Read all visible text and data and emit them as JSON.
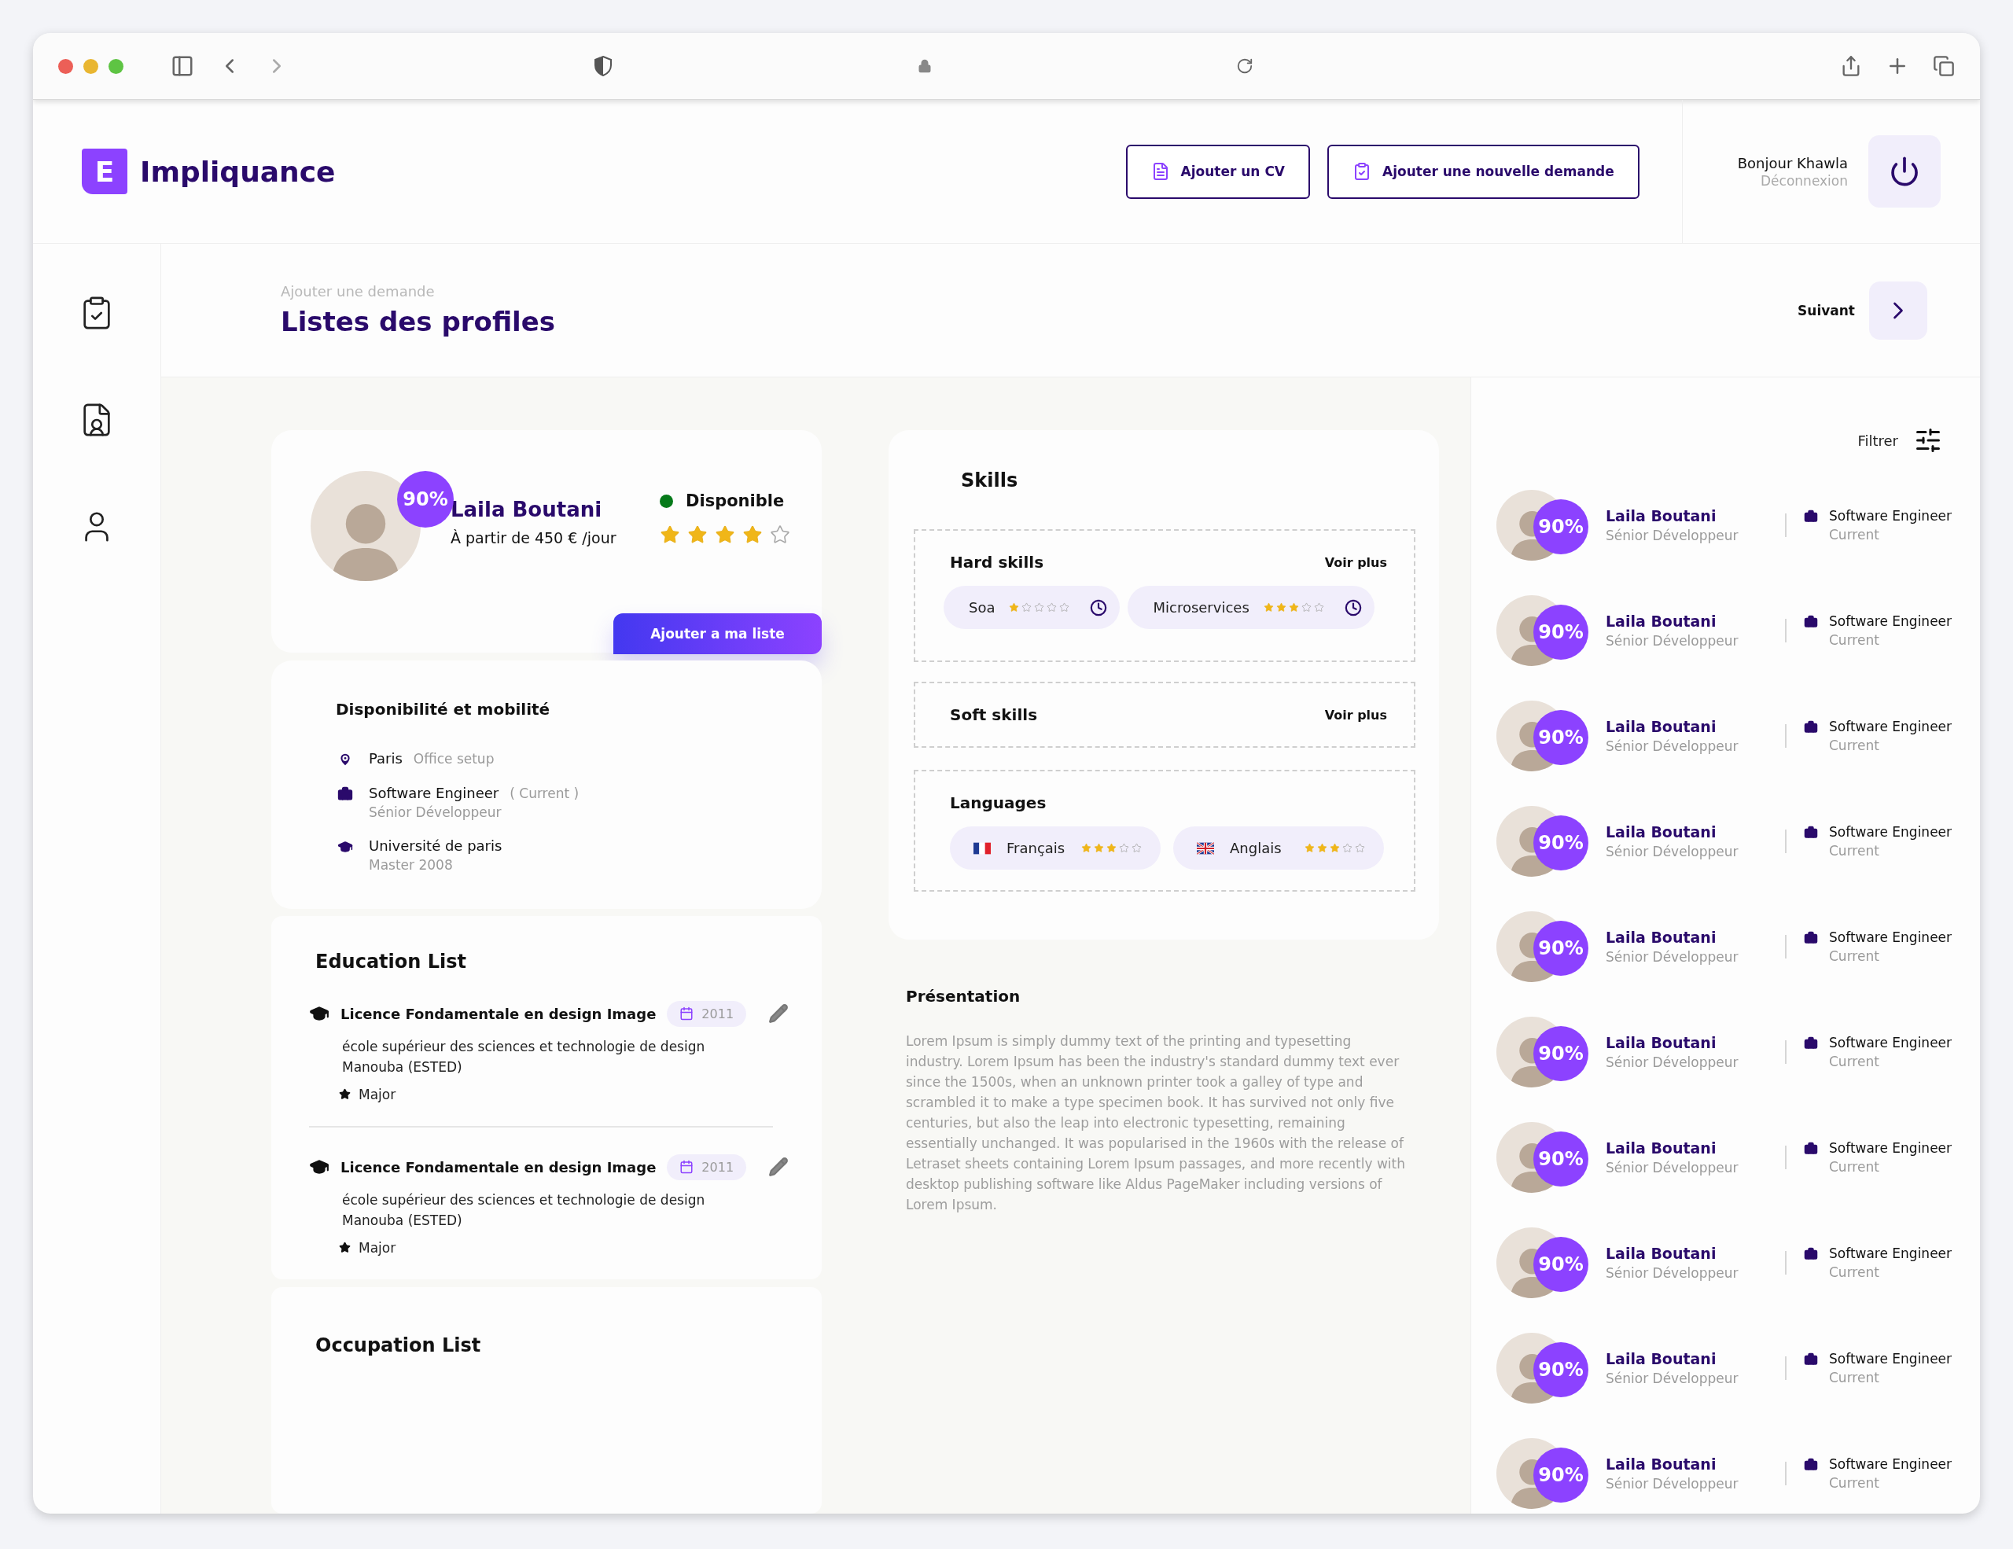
{
  "header": {
    "logo": {
      "mark": "E",
      "name": "Impliquance"
    },
    "buttons": [
      {
        "kind": "cv",
        "label": "Ajouter un CV"
      },
      {
        "kind": "request",
        "label": "Ajouter une nouvelle demande"
      }
    ],
    "user": {
      "greeting": "Bonjour Khawla",
      "logout": "Déconnexion"
    }
  },
  "page": {
    "breadcrumb": "Ajouter une demande",
    "title": "Listes des profiles",
    "next": "Suivant"
  },
  "profile": {
    "score": "90%",
    "name": "Laila Boutani",
    "rate": "À partir de 450 € /jour",
    "status": {
      "label": "Disponible",
      "available": true
    },
    "stars": 4,
    "add_button": "Ajouter a ma liste"
  },
  "mobility": {
    "title": "Disponibilité et mobilité",
    "items": [
      {
        "kind": "location",
        "label": "Paris",
        "note": "Office setup"
      },
      {
        "kind": "job",
        "label": "Software Engineer",
        "note": "( Current )",
        "sub": "Sénior Développeur"
      },
      {
        "kind": "school",
        "label": "Université de paris",
        "sub": "Master 2008"
      }
    ]
  },
  "skills": {
    "title": "Skills",
    "hard_skills": {
      "title": "Hard skills",
      "more": "Voir plus",
      "items": [
        {
          "name": "Soa",
          "stars": 1
        },
        {
          "name": "Microservices",
          "stars": 3
        }
      ]
    },
    "soft_skills": {
      "title": "Soft skills",
      "more": "Voir plus"
    },
    "languages": {
      "title": "Languages",
      "items": [
        {
          "name": "Français",
          "kind": "fr",
          "stars": 3
        },
        {
          "name": "Anglais",
          "kind": "gb",
          "stars": 3
        }
      ]
    }
  },
  "presentation": {
    "title": "Présentation",
    "text": "Lorem Ipsum is simply dummy text of the printing and typesetting industry. Lorem Ipsum has been the industry's standard dummy text ever since the 1500s, when an unknown printer took a galley of type and scrambled it to make a type specimen book. It has survived not only five centuries, but also the leap into electronic typesetting, remaining essentially unchanged. It was popularised in the 1960s with the release of Letraset sheets containing Lorem Ipsum passages, and more recently with desktop publishing software like Aldus PageMaker including versions of Lorem Ipsum."
  },
  "education": {
    "title": "Education List",
    "items": [
      {
        "title": "Licence Fondamentale en design Image",
        "year": "2011",
        "school": "école supérieur des sciences et technologie de design Manouba (ESTED)",
        "honor": "Major"
      },
      {
        "title": "Licence Fondamentale en design Image",
        "year": "2011",
        "school": "école supérieur des sciences et technologie de design Manouba (ESTED)",
        "honor": "Major"
      }
    ]
  },
  "occupation": {
    "title": "Occupation List"
  },
  "candidates": {
    "filter": "Filtrer",
    "items": [
      {
        "score": "90%",
        "name": "Laila Boutani",
        "role": "Sénior Développeur",
        "job": "Software Engineer",
        "status": "Current"
      },
      {
        "score": "90%",
        "name": "Laila Boutani",
        "role": "Sénior Développeur",
        "job": "Software Engineer",
        "status": "Current"
      },
      {
        "score": "90%",
        "name": "Laila Boutani",
        "role": "Sénior Développeur",
        "job": "Software Engineer",
        "status": "Current"
      },
      {
        "score": "90%",
        "name": "Laila Boutani",
        "role": "Sénior Développeur",
        "job": "Software Engineer",
        "status": "Current"
      },
      {
        "score": "90%",
        "name": "Laila Boutani",
        "role": "Sénior Développeur",
        "job": "Software Engineer",
        "status": "Current"
      },
      {
        "score": "90%",
        "name": "Laila Boutani",
        "role": "Sénior Développeur",
        "job": "Software Engineer",
        "status": "Current"
      },
      {
        "score": "90%",
        "name": "Laila Boutani",
        "role": "Sénior Développeur",
        "job": "Software Engineer",
        "status": "Current"
      },
      {
        "score": "90%",
        "name": "Laila Boutani",
        "role": "Sénior Développeur",
        "job": "Software Engineer",
        "status": "Current"
      },
      {
        "score": "90%",
        "name": "Laila Boutani",
        "role": "Sénior Développeur",
        "job": "Software Engineer",
        "status": "Current"
      },
      {
        "score": "90%",
        "name": "Laila Boutani",
        "role": "Sénior Développeur",
        "job": "Software Engineer",
        "status": "Current"
      }
    ]
  }
}
